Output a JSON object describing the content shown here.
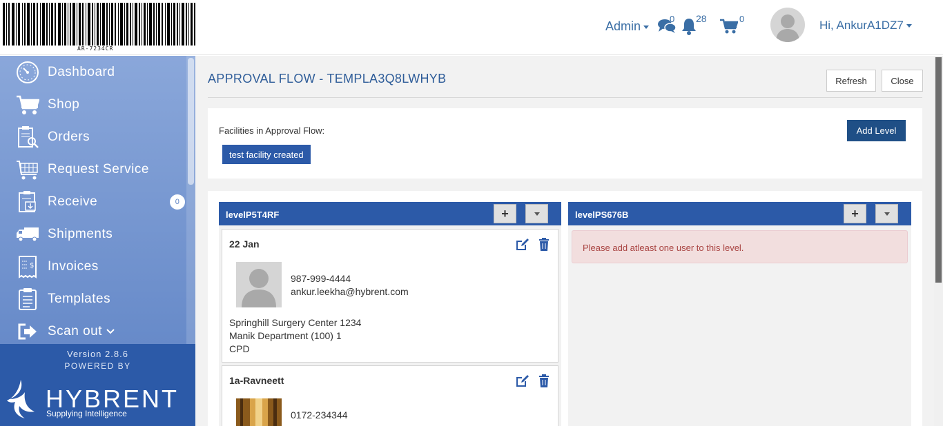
{
  "header": {
    "barcode_text": "AR-7234CR",
    "admin_label": "Admin",
    "messages_count": "0",
    "notifications_count": "28",
    "cart_count": "0",
    "greeting": "Hi, AnkurA1DZ7"
  },
  "sidebar": {
    "items": [
      {
        "label": "Dashboard",
        "icon": "dashboard-gauge-icon"
      },
      {
        "label": "Shop",
        "icon": "shopping-cart-icon"
      },
      {
        "label": "Orders",
        "icon": "clipboard-search-icon"
      },
      {
        "label": "Request Service",
        "icon": "service-cart-icon"
      },
      {
        "label": "Receive",
        "icon": "receive-clipboard-icon",
        "badge": "0"
      },
      {
        "label": "Shipments",
        "icon": "truck-icon"
      },
      {
        "label": "Invoices",
        "icon": "invoice-receipt-icon"
      },
      {
        "label": "Templates",
        "icon": "template-clipboard-icon"
      },
      {
        "label": "Scan out",
        "icon": "sign-out-icon"
      }
    ],
    "version": "Version 2.8.6",
    "powered_by": "POWERED BY",
    "brand_name": "HYBRENT",
    "brand_tagline": "Supplying Intelligence"
  },
  "main": {
    "title": "APPROVAL FLOW - TEMPLA3Q8LWHYB",
    "refresh_label": "Refresh",
    "close_label": "Close",
    "facilities_label": "Facilities in Approval Flow:",
    "facility_chip": "test facility created",
    "add_level_label": "Add Level",
    "levels": [
      {
        "name": "levelP5T4RF",
        "users": [
          {
            "name": "22 Jan",
            "phone": "987-999-4444",
            "email": "ankur.leekha@hybrent.com",
            "facility": "Springhill Surgery Center 1234",
            "department": "Manik Department (100) 1",
            "role": "CPD"
          },
          {
            "name": "1a-Ravneett",
            "phone": "0172-234344"
          }
        ]
      },
      {
        "name": "levelPS676B",
        "alert": "Please add atleast one user to this level."
      }
    ]
  },
  "colors": {
    "primary_blue": "#2c5aa8",
    "dark_blue": "#1f4f86",
    "sidebar_top": "#8aa7da",
    "alert_bg": "#f2dede",
    "alert_text": "#a94442"
  }
}
